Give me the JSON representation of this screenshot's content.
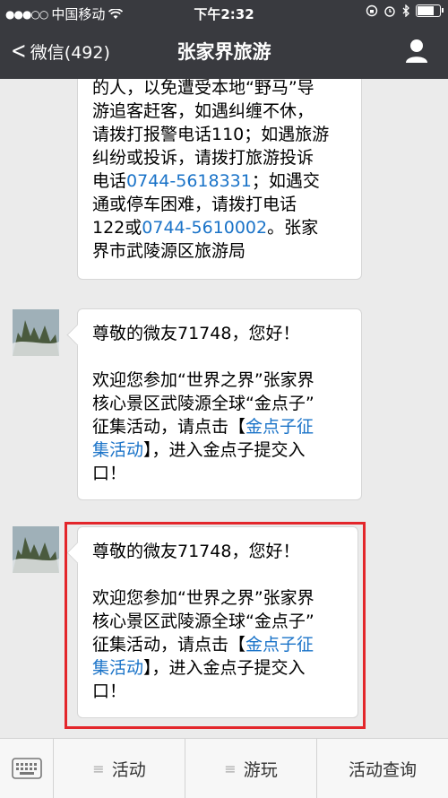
{
  "status": {
    "signal": "●●●○○",
    "carrier": "中国移动",
    "wifi": "wifi-icon",
    "time": "下午2:32"
  },
  "nav": {
    "back_label": "微信(492)",
    "title": "张家界旅游"
  },
  "messages": [
    {
      "id": "msg1",
      "lines": [
        {
          "text": "的人，以免遭受本地“野马”导"
        },
        {
          "text": "游追客赶客，如遇纠缠不休，"
        },
        {
          "text": "请拨打报警电话110；如遇旅游"
        },
        {
          "text": "纠纷或投诉，请拨打旅游投诉"
        },
        {
          "prefix": "电话",
          "link": "0744-5618331",
          "suffix": "；如遇交"
        },
        {
          "text": "通或停车困难，请拨打电话"
        },
        {
          "prefix": "122或",
          "link": "0744-5610002",
          "suffix": "。张家"
        },
        {
          "text": "界市武陵源区旅游局"
        }
      ]
    },
    {
      "id": "msg2",
      "greeting": "尊敬的微友71748，您好！",
      "body_l1": "欢迎您参加“世界之界”张家界",
      "body_l2": "核心景区武陵源全球“金点子”",
      "body_l3_prefix": "征集活动，请点击【",
      "link_part1": "金点子征",
      "link_part2": "集活动",
      "body_l4_suffix": "】，进入金点子提交入",
      "body_l5": "口！"
    },
    {
      "id": "msg3",
      "greeting": "尊敬的微友71748，您好！",
      "body_l1": "欢迎您参加“世界之界”张家界",
      "body_l2": "核心景区武陵源全球“金点子”",
      "body_l3_prefix": "征集活动，请点击【",
      "link_part1": "金点子征",
      "link_part2": "集活动",
      "body_l4_suffix": "】，进入金点子提交入",
      "body_l5": "口！"
    }
  ],
  "bottom_menu": {
    "keyboard_icon": "keyboard-icon",
    "menu_icon": "≡",
    "item1": "活动",
    "item2": "游玩",
    "item3": "活动查询"
  },
  "colors": {
    "nav_bg": "#393a3f",
    "link": "#1a73c8",
    "highlight": "#e3262b",
    "chat_bg": "#ebebeb"
  }
}
